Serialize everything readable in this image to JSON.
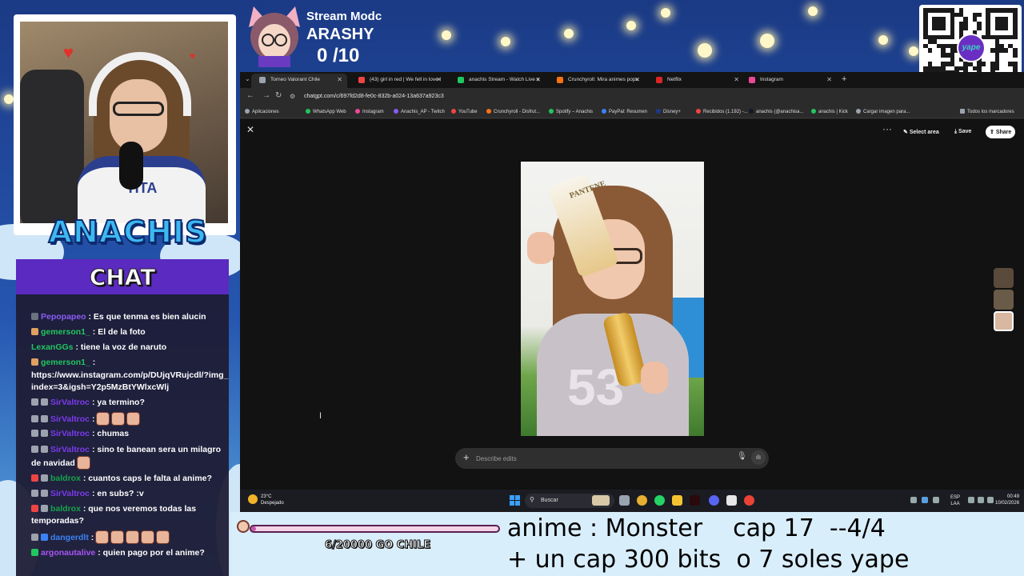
{
  "overlay": {
    "streamer_name": "ANACHIS",
    "chat_header": "CHAT",
    "mod_title": "Stream Modc",
    "mod_name": "ARASHY",
    "mod_count": "0 /10",
    "qr_badge": "yape"
  },
  "chat": [
    {
      "user": "Pepopapeo",
      "user_color": "#8b5cf6",
      "text": ": Es que tenma es bien alucin",
      "badges": [
        "#6b7280"
      ],
      "emotes": 0
    },
    {
      "user": "gemerson1_",
      "user_color": "#22c55e",
      "text": ": El de la foto",
      "badges": [
        "#e0a060"
      ],
      "emotes": 0
    },
    {
      "user": "LexanGGs",
      "user_color": "#22c55e",
      "text": ": tiene la voz de naruto",
      "badges": [],
      "emotes": 0
    },
    {
      "user": "gemerson1_",
      "user_color": "#22c55e",
      "text": ":",
      "badges": [
        "#e0a060"
      ],
      "emotes": 0
    },
    {
      "user": "",
      "user_color": "#ffffff",
      "text": "https://www.instagram.com/p/DUjqVRujcdl/?img_index=3&igsh=Y2p5MzBtYWlxcWlj",
      "badges": [],
      "emotes": 0
    },
    {
      "user": "SirValtroc",
      "user_color": "#7c3aed",
      "text": ": ya termino?",
      "badges": [
        "#9ca3af",
        "#9ca3af"
      ],
      "emotes": 0
    },
    {
      "user": "SirValtroc",
      "user_color": "#7c3aed",
      "text": ":",
      "badges": [
        "#9ca3af",
        "#9ca3af"
      ],
      "emotes": 3
    },
    {
      "user": "SirValtroc",
      "user_color": "#7c3aed",
      "text": ": chumas",
      "badges": [
        "#9ca3af",
        "#9ca3af"
      ],
      "emotes": 0
    },
    {
      "user": "SirValtroc",
      "user_color": "#7c3aed",
      "text": ": sino te banean sera un milagro de navidad",
      "badges": [
        "#9ca3af",
        "#9ca3af"
      ],
      "emotes": 1
    },
    {
      "user": "baldrox",
      "user_color": "#16a34a",
      "text": ": cuantos caps le falta al anime?",
      "badges": [
        "#ef4444",
        "#9ca3af"
      ],
      "emotes": 0
    },
    {
      "user": "SirValtroc",
      "user_color": "#7c3aed",
      "text": ": en subs? :v",
      "badges": [
        "#9ca3af",
        "#9ca3af"
      ],
      "emotes": 0
    },
    {
      "user": "baldrox",
      "user_color": "#16a34a",
      "text": ": que nos veremos todas las temporadas?",
      "badges": [
        "#ef4444",
        "#9ca3af"
      ],
      "emotes": 0
    },
    {
      "user": "dangerdlt",
      "user_color": "#3b82f6",
      "text": ":",
      "badges": [
        "#9ca3af",
        "#3b82f6"
      ],
      "emotes": 5
    },
    {
      "user": "argonautalive",
      "user_color": "#a855f7",
      "text": ": quien pago por el anime?",
      "badges": [
        "#22c55e"
      ],
      "emotes": 0
    }
  ],
  "browser": {
    "tabs": [
      {
        "label": "Torneo Valorant Chile",
        "icon_color": "#9ca3af",
        "active": true
      },
      {
        "label": "(43) girl in red | We fell in love i",
        "icon_color": "#ef4444",
        "active": false
      },
      {
        "label": "anachis Stream - Watch Live o",
        "icon_color": "#22c55e",
        "active": false
      },
      {
        "label": "Crunchyroll: Mira animes popu",
        "icon_color": "#f97316",
        "active": false
      },
      {
        "label": "Netflix",
        "icon_color": "#dc2626",
        "active": false
      },
      {
        "label": "Instagram",
        "icon_color": "#ec4899",
        "active": false
      }
    ],
    "url": "chatgpt.com/c/697fd2d8-fe0c-832b-a024-13a637a923c3",
    "bookmarks": [
      {
        "label": "Aplicaciones",
        "color": "#9ca3af"
      },
      {
        "label": "WhatsApp Web",
        "color": "#22c55e"
      },
      {
        "label": "Instagram",
        "color": "#ec4899"
      },
      {
        "label": "Anachis_AP - Twitch",
        "color": "#8b5cf6"
      },
      {
        "label": "YouTube",
        "color": "#ef4444"
      },
      {
        "label": "Crunchyroll - Disfrut...",
        "color": "#f97316"
      },
      {
        "label": "Spotify – Anachis",
        "color": "#22c55e"
      },
      {
        "label": "PayPal: Resumen",
        "color": "#3b82f6"
      },
      {
        "label": "Disney+",
        "color": "#1e3a8a"
      },
      {
        "label": "Recibidos (1.192) -...",
        "color": "#ef4444"
      },
      {
        "label": "anachis (@anachisa...",
        "color": "#111827"
      },
      {
        "label": "anachis | Kick",
        "color": "#22c55e"
      },
      {
        "label": "Cargar imagen para...",
        "color": "#9ca3af"
      }
    ],
    "all_bookmarks": "Todos los marcadores",
    "toolbar": {
      "select_area": "Select area",
      "save": "Save",
      "share": "Share"
    },
    "photo_text": {
      "product": "PANTENE",
      "shirt_number": "53"
    },
    "prompt": {
      "placeholder": "Describe edits",
      "value": ""
    }
  },
  "taskbar": {
    "weather_temp": "23°C",
    "weather_desc": "Despejado",
    "search_label": "Buscar",
    "lang_1": "ESP",
    "lang_2": "LAA",
    "time": "00:49",
    "date": "10/02/2026"
  },
  "bottom": {
    "goal_text": "6/20000 GO CHILE",
    "goal_progress": 0.0003,
    "announce_line1": "anime : Monster    cap 17  --4/4",
    "announce_line2": "+ un cap 300 bits  o 7 soles yape"
  }
}
